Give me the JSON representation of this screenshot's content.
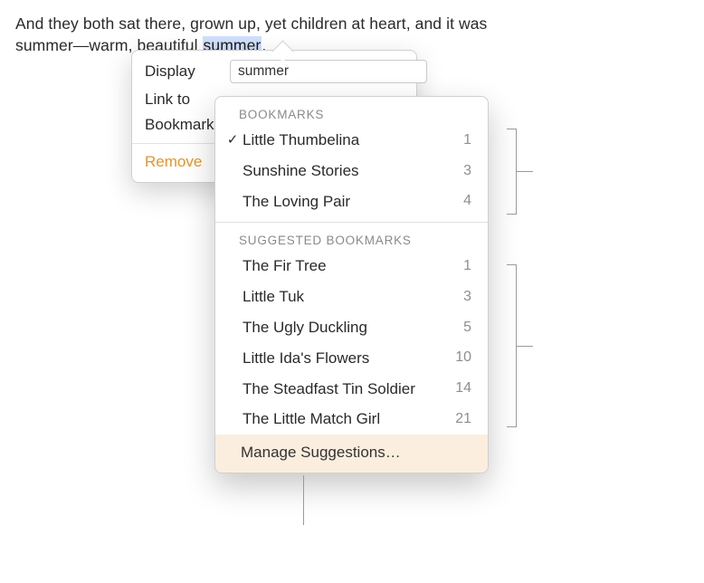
{
  "body_text": {
    "prefix": "And they both sat there, grown up, yet children at heart, and it was summer—warm, beautiful ",
    "highlight": "summer",
    "suffix": "."
  },
  "panel": {
    "display_label": "Display",
    "display_value": "summer",
    "linkto_label": "Link to",
    "bookmark_label": "Bookmark",
    "remove_label": "Remove"
  },
  "menu": {
    "bookmarks_header": "BOOKMARKS",
    "bookmarks": [
      {
        "label": "Little Thumbelina",
        "count": "1",
        "checked": true
      },
      {
        "label": "Sunshine Stories",
        "count": "3",
        "checked": false
      },
      {
        "label": "The Loving Pair",
        "count": "4",
        "checked": false
      }
    ],
    "suggested_header": "SUGGESTED BOOKMARKS",
    "suggested": [
      {
        "label": "The Fir Tree",
        "count": "1"
      },
      {
        "label": "Little Tuk",
        "count": "3"
      },
      {
        "label": "The Ugly Duckling",
        "count": "5"
      },
      {
        "label": "Little Ida's Flowers",
        "count": "10"
      },
      {
        "label": "The Steadfast Tin Soldier",
        "count": "14"
      },
      {
        "label": "The Little Match Girl",
        "count": "21"
      }
    ],
    "manage_label": "Manage Suggestions…"
  }
}
